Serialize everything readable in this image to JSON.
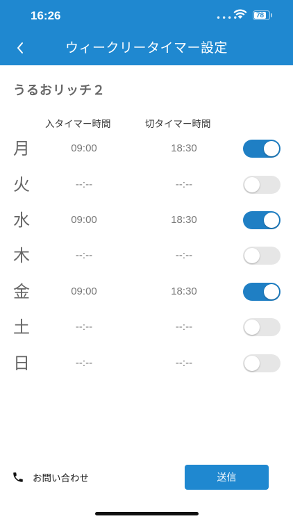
{
  "status_bar": {
    "time": "16:26",
    "battery": "78"
  },
  "nav": {
    "title": "ウィークリータイマー設定"
  },
  "device_name": "うるおリッチ２",
  "columns": {
    "on_timer": "入タイマー時間",
    "off_timer": "切タイマー時間"
  },
  "days": [
    {
      "label": "月",
      "on_time": "09:00",
      "off_time": "18:30",
      "enabled": true
    },
    {
      "label": "火",
      "on_time": "--:--",
      "off_time": "--:--",
      "enabled": false
    },
    {
      "label": "水",
      "on_time": "09:00",
      "off_time": "18:30",
      "enabled": true
    },
    {
      "label": "木",
      "on_time": "--:--",
      "off_time": "--:--",
      "enabled": false
    },
    {
      "label": "金",
      "on_time": "09:00",
      "off_time": "18:30",
      "enabled": true
    },
    {
      "label": "土",
      "on_time": "--:--",
      "off_time": "--:--",
      "enabled": false
    },
    {
      "label": "日",
      "on_time": "--:--",
      "off_time": "--:--",
      "enabled": false
    }
  ],
  "footer": {
    "contact_label": "お問い合わせ",
    "send_label": "送信"
  },
  "icons": {
    "back": "chevron-left-icon",
    "contact": "phone-icon",
    "wifi": "wifi-icon",
    "battery": "battery-icon"
  },
  "colors": {
    "primary": "#1f88d0",
    "toggle_on": "#1f7fc4",
    "toggle_off": "#e6e6e6"
  }
}
